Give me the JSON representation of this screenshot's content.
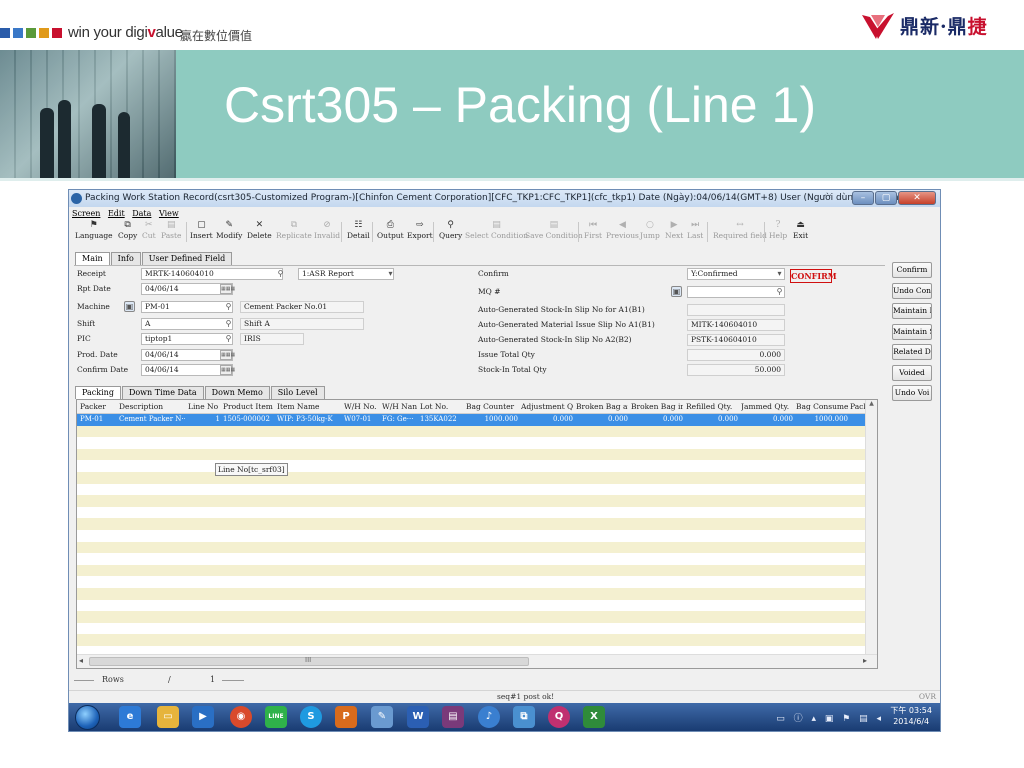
{
  "slide": {
    "brand_left": "win your digi",
    "brand_accent": "v",
    "brand_tail": "alue",
    "brand_cn": "贏在數位價值",
    "logo_text_a": "鼎新",
    "logo_dot": "·",
    "logo_text_b": "鼎",
    "logo_text_c": "捷",
    "title": "Csrt305 – Packing (Line 1)",
    "colors": {
      "band": "#8ecbc0",
      "brand_red": "#c8102e",
      "square_1": "#2a5caa",
      "square_2": "#3a78c7",
      "square_3": "#5a9a3a",
      "square_4": "#e09a1a",
      "square_5": "#c8102e"
    }
  },
  "window": {
    "title": "Packing Work Station Record(csrt305-Customized Program-)[Chinfon Cement Corporation][CFC_TKP1:CFC_TKP1](cfc_tkp1)  Date (Ngày):04/06/14(GMT+8)  User (Người dùng):Digiwin",
    "min_icon": "minimize-icon",
    "max_icon": "maximize-icon",
    "close_icon": "close-icon"
  },
  "menu": [
    "Screen",
    "Edit",
    "Data",
    "View"
  ],
  "toolbar": [
    {
      "label": "Language",
      "icon": "⚑"
    },
    {
      "label": "Copy",
      "icon": "⧉"
    },
    {
      "label": "Cut",
      "icon": "✂"
    },
    {
      "label": "Paste",
      "icon": "▤"
    },
    {
      "label": "Insert",
      "icon": "▢"
    },
    {
      "label": "Modify",
      "icon": "✎"
    },
    {
      "label": "Delete",
      "icon": "✕"
    },
    {
      "label": "Replicate",
      "icon": "⧉"
    },
    {
      "label": "Invalid",
      "icon": "⊘"
    },
    {
      "label": "Detail",
      "icon": "☷"
    },
    {
      "label": "Output",
      "icon": "⎙"
    },
    {
      "label": "Export",
      "icon": "⇨"
    },
    {
      "label": "Query",
      "icon": "⚲"
    },
    {
      "label": "Select Condition",
      "icon": "▤"
    },
    {
      "label": "Save Condition",
      "icon": "▤"
    },
    {
      "label": "First",
      "icon": "⏮"
    },
    {
      "label": "Previous",
      "icon": "◀"
    },
    {
      "label": "Jump",
      "icon": "○"
    },
    {
      "label": "Next",
      "icon": "▶"
    },
    {
      "label": "Last",
      "icon": "⏭"
    },
    {
      "label": "Required field",
      "icon": "↔"
    },
    {
      "label": "Help",
      "icon": "?"
    },
    {
      "label": "Exit",
      "icon": "⏏"
    }
  ],
  "main_tabs": [
    "Main",
    "Info",
    "User Defined Field"
  ],
  "form": {
    "receipt_label": "Receipt",
    "receipt_value": "MRTK-140604010",
    "report_value": "1:ASR Report",
    "rpt_date_label": "Rpt Date",
    "rpt_date_value": "04/06/14",
    "machine_label": "Machine",
    "machine_value": "PM-01",
    "machine_name": "Cement Packer No.01",
    "shift_label": "Shift",
    "shift_value": "A",
    "shift_name": "Shift A",
    "pic_label": "PIC",
    "pic_value": "tiptop1",
    "pic_name": "IRIS",
    "prod_date_label": "Prod. Date",
    "prod_date_value": "04/06/14",
    "confirm_date_label": "Confirm Date",
    "confirm_date_value": "04/06/14",
    "confirm_label": "Confirm",
    "confirm_value": "Y:Confirmed",
    "confirm_stamp": "CONFIRM",
    "mq_label": "MQ #",
    "b1_label": "Auto-Generated Stock-In Slip No for A1(B1)",
    "mat_label": "Auto-Generated Material Issue Slip No A1(B1)",
    "mat_value": "MITK-140604010",
    "b2_label": "Auto-Generated Stock-In Slip No A2(B2)",
    "b2_value": "PSTK-140604010",
    "issue_label": "Issue Total Qty",
    "issue_value": "0.000",
    "stockin_label": "Stock-In Total Qty",
    "stockin_value": "50.000",
    "cal_text": "▦▦▦"
  },
  "side_buttons": [
    "Confirm",
    "Undo Con",
    "Maintain I",
    "Maintain S",
    "Related D",
    "Voided",
    "Undo Voi"
  ],
  "grid_tabs": [
    "Packing",
    "Down Time Data",
    "Down Memo",
    "Silo Level"
  ],
  "grid": {
    "columns": [
      "Packer",
      "Description",
      "Line No",
      "Product Item N",
      "Item Name",
      "W/H No.",
      "W/H Nan",
      "Lot No.",
      "Bag Counter",
      "Adjustment Qty",
      "Broken Bag at F",
      "Broken Bag in T",
      "Refilled Qty.",
      "Jammed Qty.",
      "Bag Consumed",
      "Pack"
    ],
    "rows": [
      [
        "PM-01",
        "Cement Packer N···",
        "1",
        "1505-000002",
        "WIP: P3-50kg-K",
        "W07-01",
        "FG: Ge···",
        "135KA022",
        "1000.000",
        "0.000",
        "0.000",
        "0.000",
        "0.000",
        "0.000",
        "1000.000",
        ""
      ]
    ],
    "tooltip": "Line No[tc_srf03]",
    "scroll_mark": "III"
  },
  "rows_bar": {
    "label": "Rows",
    "sep": "/",
    "count": "1"
  },
  "status": {
    "message": "seq#1 post ok!",
    "mode": "OVR"
  },
  "taskbar": {
    "apps": [
      {
        "name": "ie",
        "glyph": "e",
        "color": "#2d7ad6"
      },
      {
        "name": "explorer",
        "glyph": "▭",
        "color": "#e6b43c"
      },
      {
        "name": "media",
        "glyph": "▶",
        "color": "#2a6fc4"
      },
      {
        "name": "chrome",
        "glyph": "◉",
        "color": "#d94a2b"
      },
      {
        "name": "line",
        "glyph": "LINE",
        "color": "#2fb24a"
      },
      {
        "name": "skype",
        "glyph": "S",
        "color": "#1f9ae0"
      },
      {
        "name": "powerpoint",
        "glyph": "P",
        "color": "#d86b1c"
      },
      {
        "name": "paint",
        "glyph": "✎",
        "color": "#6a9ad0"
      },
      {
        "name": "word",
        "glyph": "W",
        "color": "#2b5fb3"
      },
      {
        "name": "winrar",
        "glyph": "▤",
        "color": "#7a3a7a"
      },
      {
        "name": "itunes",
        "glyph": "♪",
        "color": "#3a7fd0"
      },
      {
        "name": "network",
        "glyph": "⧉",
        "color": "#4a90d0"
      },
      {
        "name": "q-app",
        "glyph": "Q",
        "color": "#c03070"
      },
      {
        "name": "excel",
        "glyph": "X",
        "color": "#2f8b3a"
      }
    ],
    "tray_icons": "▭ ⓘ ▴ ▣ ⚑ ▤ ◂",
    "time": "下午 03:54",
    "date": "2014/6/4"
  }
}
